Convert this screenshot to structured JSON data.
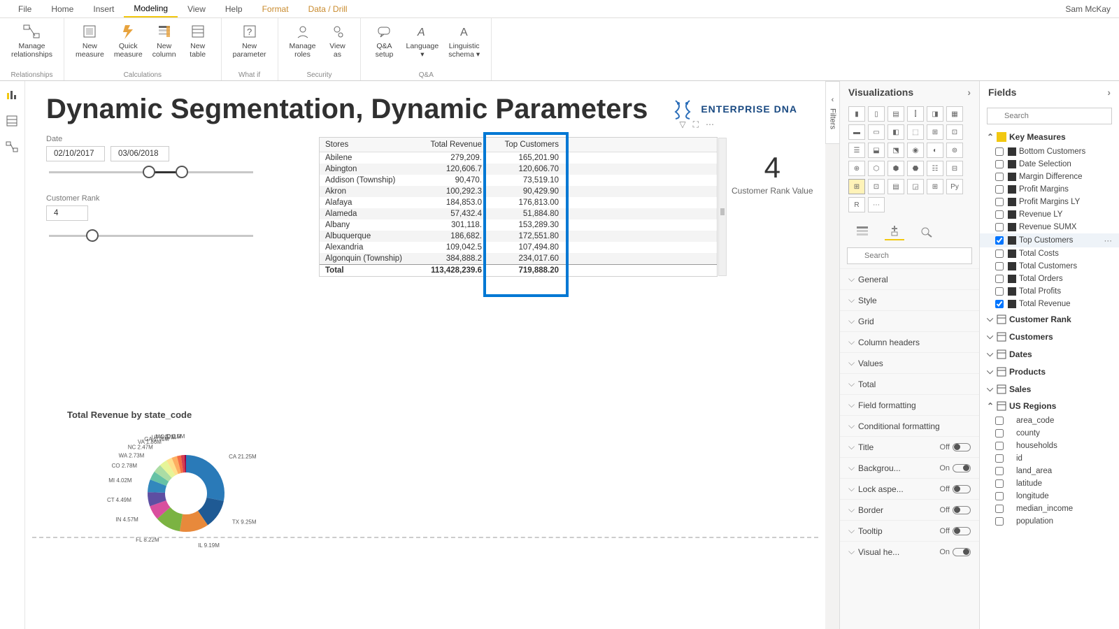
{
  "user": "Sam McKay",
  "menu": {
    "file": "File",
    "home": "Home",
    "insert": "Insert",
    "modeling": "Modeling",
    "view": "View",
    "help": "Help",
    "format": "Format",
    "data": "Data / Drill"
  },
  "ribbon": {
    "relationships": "Relationships",
    "manage_rel": "Manage\nrelationships",
    "calculations": "Calculations",
    "new_measure": "New\nmeasure",
    "quick_measure": "Quick\nmeasure",
    "new_column": "New\ncolumn",
    "new_table": "New\ntable",
    "whatif": "What if",
    "new_param": "New\nparameter",
    "security": "Security",
    "manage_roles": "Manage\nroles",
    "view_as": "View\nas",
    "qa": "Q&A",
    "qa_setup": "Q&A\nsetup",
    "language": "Language\n▾",
    "ling": "Linguistic\nschema ▾"
  },
  "report": {
    "title": "Dynamic Segmentation, Dynamic Parameters",
    "brand": "ENTERPRISE DNA",
    "date_label": "Date",
    "date_from": "02/10/2017",
    "date_to": "03/06/2018",
    "rank_label": "Customer Rank",
    "rank_value": "4",
    "card_value": "4",
    "card_caption": "Customer Rank Value",
    "donut_title": "Total Revenue by state_code"
  },
  "table": {
    "h1": "Stores",
    "h2": "Total Revenue",
    "h3": "Top Customers",
    "rows": [
      {
        "s": "Abilene",
        "r": "279,209.",
        "t": "165,201.90"
      },
      {
        "s": "Abington",
        "r": "120,606.7",
        "t": "120,606.70"
      },
      {
        "s": "Addison (Township)",
        "r": "90,470.",
        "t": "73,519.10"
      },
      {
        "s": "Akron",
        "r": "100,292.3",
        "t": "90,429.90"
      },
      {
        "s": "Alafaya",
        "r": "184,853.0",
        "t": "176,813.00"
      },
      {
        "s": "Alameda",
        "r": "57,432.4",
        "t": "51,884.80"
      },
      {
        "s": "Albany",
        "r": "301,118.",
        "t": "153,289.30"
      },
      {
        "s": "Albuquerque",
        "r": "186,682.",
        "t": "172,551.80"
      },
      {
        "s": "Alexandria",
        "r": "109,042.5",
        "t": "107,494.80"
      },
      {
        "s": "Algonquin (Township)",
        "r": "384,888.2",
        "t": "234,017.60"
      }
    ],
    "total_label": "Total",
    "total_rev": "113,428,239.6",
    "total_top": "719,888.20"
  },
  "chart_data": {
    "type": "pie",
    "title": "Total Revenue by state_code",
    "slices": [
      {
        "label": "CA",
        "value": 21.25,
        "unit": "M"
      },
      {
        "label": "TX",
        "value": 9.25,
        "unit": "M"
      },
      {
        "label": "IL",
        "value": 9.19,
        "unit": "M"
      },
      {
        "label": "FL",
        "value": 8.22,
        "unit": "M"
      },
      {
        "label": "IN",
        "value": 4.57,
        "unit": "M"
      },
      {
        "label": "CT",
        "value": 4.49,
        "unit": "M"
      },
      {
        "label": "MI",
        "value": 4.02,
        "unit": "M"
      },
      {
        "label": "CO",
        "value": 2.78,
        "unit": "M"
      },
      {
        "label": "WA",
        "value": 2.73,
        "unit": "M"
      },
      {
        "label": "NC",
        "value": 2.47,
        "unit": "M"
      },
      {
        "label": "VA",
        "value": 1.86,
        "unit": "M"
      },
      {
        "label": "GA",
        "value": 1.71,
        "unit": "M"
      },
      {
        "label": "UT",
        "value": 1.27,
        "unit": "M"
      },
      {
        "label": "MO",
        "value": 1.11,
        "unit": "M"
      },
      {
        "label": "ID",
        "value": 0.5,
        "unit": "M"
      }
    ]
  },
  "viz": {
    "header": "Visualizations",
    "search_placeholder": "Search",
    "format_sections": [
      {
        "label": "General"
      },
      {
        "label": "Style"
      },
      {
        "label": "Grid"
      },
      {
        "label": "Column headers"
      },
      {
        "label": "Values"
      },
      {
        "label": "Total"
      },
      {
        "label": "Field formatting"
      },
      {
        "label": "Conditional formatting"
      },
      {
        "label": "Title",
        "toggle": "Off"
      },
      {
        "label": "Backgrou...",
        "toggle": "On"
      },
      {
        "label": "Lock aspe...",
        "toggle": "Off"
      },
      {
        "label": "Border",
        "toggle": "Off"
      },
      {
        "label": "Tooltip",
        "toggle": "Off"
      },
      {
        "label": "Visual he...",
        "toggle": "On"
      }
    ]
  },
  "fields": {
    "header": "Fields",
    "search_placeholder": "Search",
    "measures_group": "Key Measures",
    "measures": [
      {
        "name": "Bottom Customers",
        "checked": false
      },
      {
        "name": "Date Selection",
        "checked": false
      },
      {
        "name": "Margin Difference",
        "checked": false
      },
      {
        "name": "Profit Margins",
        "checked": false
      },
      {
        "name": "Profit Margins LY",
        "checked": false
      },
      {
        "name": "Revenue LY",
        "checked": false
      },
      {
        "name": "Revenue SUMX",
        "checked": false
      },
      {
        "name": "Top Customers",
        "checked": true,
        "hover": true
      },
      {
        "name": "Total Costs",
        "checked": false
      },
      {
        "name": "Total Customers",
        "checked": false
      },
      {
        "name": "Total Orders",
        "checked": false
      },
      {
        "name": "Total Profits",
        "checked": false
      },
      {
        "name": "Total Revenue",
        "checked": true
      }
    ],
    "tables": [
      {
        "name": "Customer Rank",
        "icon": "param"
      },
      {
        "name": "Customers",
        "icon": "table"
      },
      {
        "name": "Dates",
        "icon": "table"
      },
      {
        "name": "Products",
        "icon": "param"
      },
      {
        "name": "Sales",
        "icon": "table"
      },
      {
        "name": "US Regions",
        "icon": "param",
        "expanded": true
      }
    ],
    "region_cols": [
      "area_code",
      "county",
      "households",
      "id",
      "land_area",
      "latitude",
      "longitude",
      "median_income",
      "population"
    ]
  },
  "filters_label": "Filters"
}
